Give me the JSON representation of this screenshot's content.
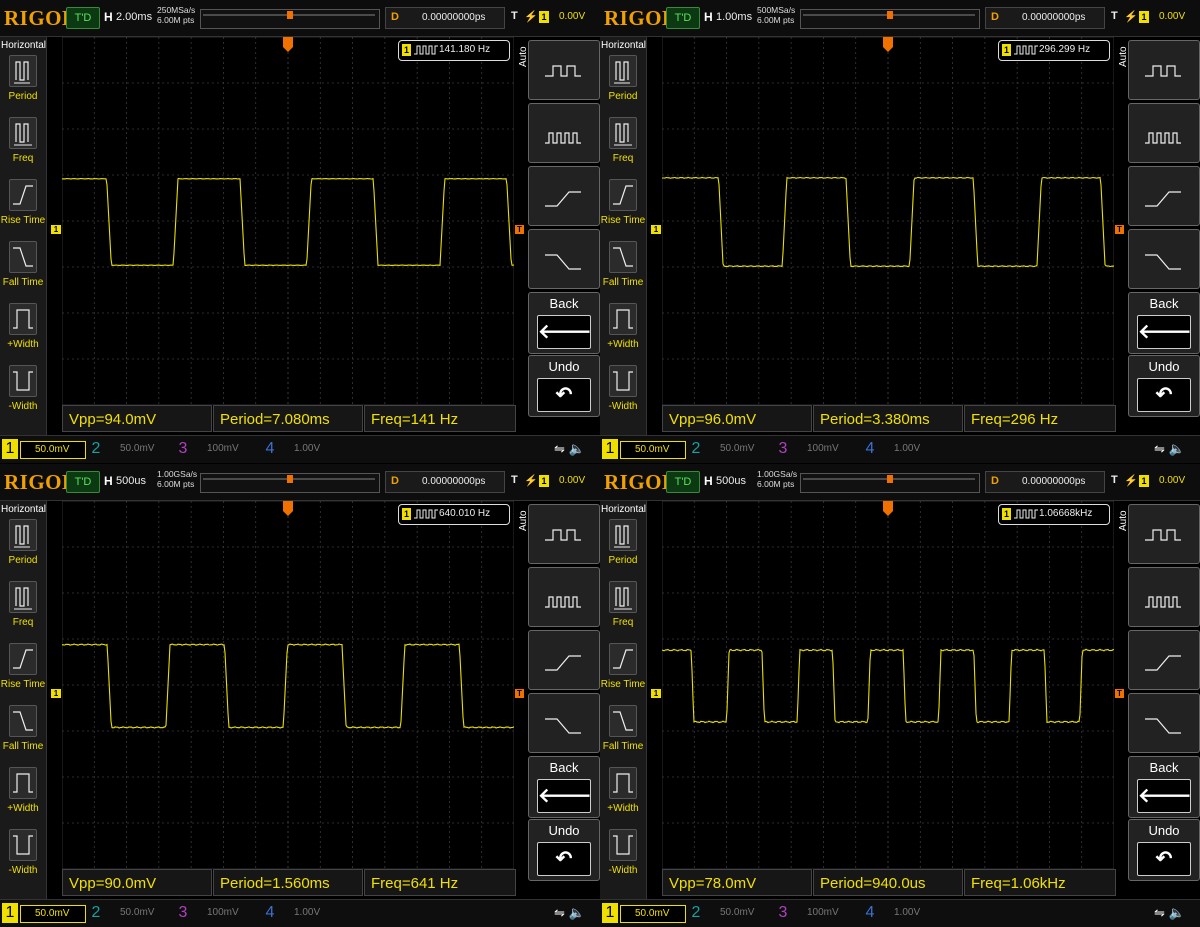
{
  "scopes": [
    {
      "brand": "RIGOL",
      "trig_mode": "T'D",
      "h_label": "H",
      "timebase": "2.00ms",
      "sample_rate": "250MSa/s",
      "mem_depth": "6.00M pts",
      "delay_label": "D",
      "delay_value": "0.00000000ps",
      "trig_label": "T",
      "trig_channel": "1",
      "trig_level": "0.00V",
      "freq_channel": "1",
      "freq_value": "141.180 Hz",
      "vpp": "Vpp=94.0mV",
      "period": "Period=7.080ms",
      "freq": "Freq=141 Hz",
      "ch1_scale": "50.0mV",
      "signal": {
        "cycles": 3.39,
        "phase": 0.13,
        "amplitude": 0.94,
        "ripple": 0.07
      }
    },
    {
      "brand": "RIGOL",
      "trig_mode": "T'D",
      "h_label": "H",
      "timebase": "1.00ms",
      "sample_rate": "500MSa/s",
      "mem_depth": "6.00M pts",
      "delay_label": "D",
      "delay_value": "0.00000000ps",
      "trig_label": "T",
      "trig_channel": "1",
      "trig_level": "0.00V",
      "freq_channel": "1",
      "freq_value": "296.299 Hz",
      "vpp": "Vpp=96.0mV",
      "period": "Period=3.380ms",
      "freq": "Freq=296 Hz",
      "ch1_scale": "50.0mV",
      "signal": {
        "cycles": 3.55,
        "phase": 0.02,
        "amplitude": 0.96,
        "ripple": 0.15
      }
    },
    {
      "brand": "RIGOL",
      "trig_mode": "T'D",
      "h_label": "H",
      "timebase": "500us",
      "sample_rate": "1.00GSa/s",
      "mem_depth": "6.00M pts",
      "delay_label": "D",
      "delay_value": "0.00000000ps",
      "trig_label": "T",
      "trig_channel": "1",
      "trig_level": "0.00V",
      "freq_channel": "1",
      "freq_value": "640.010 Hz",
      "vpp": "Vpp=90.0mV",
      "period": "Period=1.560ms",
      "freq": "Freq=641 Hz",
      "ch1_scale": "50.0mV",
      "signal": {
        "cycles": 3.85,
        "phase": 0.08,
        "amplitude": 0.9,
        "ripple": 0.2
      }
    },
    {
      "brand": "RIGOL",
      "trig_mode": "T'D",
      "h_label": "H",
      "timebase": "500us",
      "sample_rate": "1.00GSa/s",
      "mem_depth": "6.00M pts",
      "delay_label": "D",
      "delay_value": "0.00000000ps",
      "trig_label": "T",
      "trig_channel": "1",
      "trig_level": "0.00V",
      "freq_channel": "1",
      "freq_value": "1.06668kHz",
      "vpp": "Vpp=78.0mV",
      "period": "Period=940.0us",
      "freq": "Freq=1.06kHz",
      "ch1_scale": "50.0mV",
      "signal": {
        "cycles": 6.4,
        "phase": 0.05,
        "amplitude": 0.78,
        "ripple": 0.25
      }
    }
  ],
  "left_menu": {
    "title": "Horizontal",
    "items": [
      "Period",
      "Freq",
      "Rise Time",
      "Fall Time",
      "+Width",
      "-Width"
    ]
  },
  "right_menu": {
    "auto_label": "Auto",
    "back_label": "Back",
    "undo_label": "Undo"
  },
  "channels": [
    {
      "num": "1",
      "scale": "50.0mV"
    },
    {
      "num": "2",
      "scale": "50.0mV"
    },
    {
      "num": "3",
      "scale": "100mV"
    },
    {
      "num": "4",
      "scale": "1.00V"
    }
  ],
  "colors": {
    "trace": "#e8e000",
    "accent": "#f0a000",
    "grid": "#3a3a3a"
  }
}
